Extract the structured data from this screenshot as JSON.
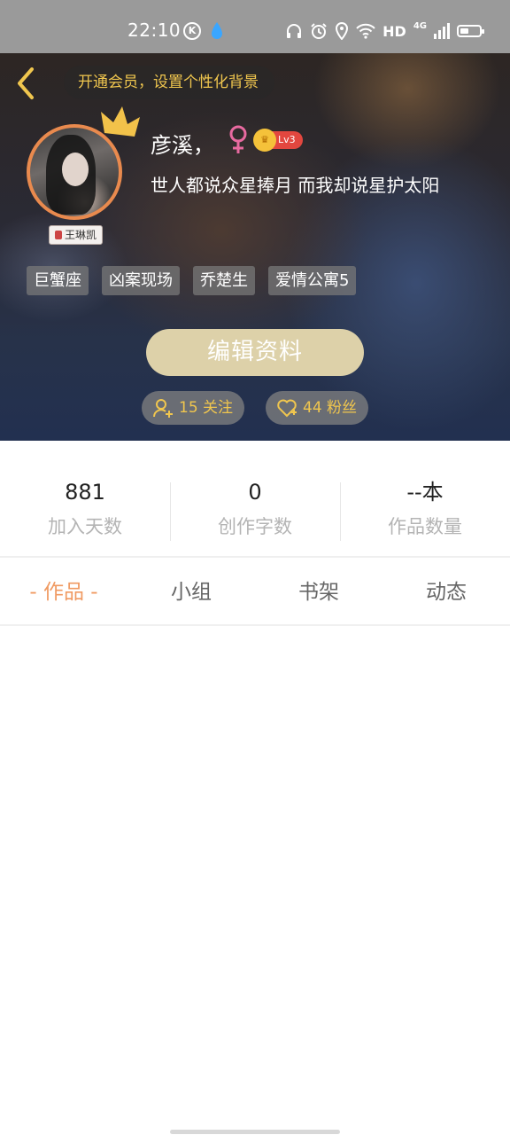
{
  "status_bar": {
    "time": "22:10",
    "network_label": "HD",
    "signal_label": "4G",
    "icons": [
      "k-icon",
      "drop-icon",
      "headphone-icon",
      "alarm-icon",
      "location-icon",
      "wifi-icon",
      "signal-icon",
      "battery-icon"
    ]
  },
  "header": {
    "vip_banner": "开通会员，设置个性化背景",
    "username": "彦溪，",
    "gender_symbol": "♀",
    "level": "Lv3",
    "bio": "世人都说众星捧月 而我却说星护太阳",
    "fan_tag": "王琳凯",
    "tags": [
      {
        "label": "巨蟹座"
      },
      {
        "label": "凶案现场"
      },
      {
        "label": "乔楚生"
      },
      {
        "label": "爱情公寓5"
      }
    ],
    "edit_button": "编辑资料",
    "follow_label": "15 关注",
    "fans_label": "44 粉丝"
  },
  "stats": [
    {
      "value": "881",
      "label": "加入天数"
    },
    {
      "value": "0",
      "label": "创作字数"
    },
    {
      "value": "--本",
      "label": "作品数量"
    }
  ],
  "tabs": [
    {
      "label": "- 作品 -",
      "active": true
    },
    {
      "label": "小组",
      "active": false
    },
    {
      "label": "书架",
      "active": false
    },
    {
      "label": "动态",
      "active": false
    }
  ],
  "colors": {
    "accent_orange": "#f09a62",
    "vip_gold": "#f0c64e",
    "edit_button_bg": "#ddd1a9",
    "level_red": "#e2473f"
  }
}
